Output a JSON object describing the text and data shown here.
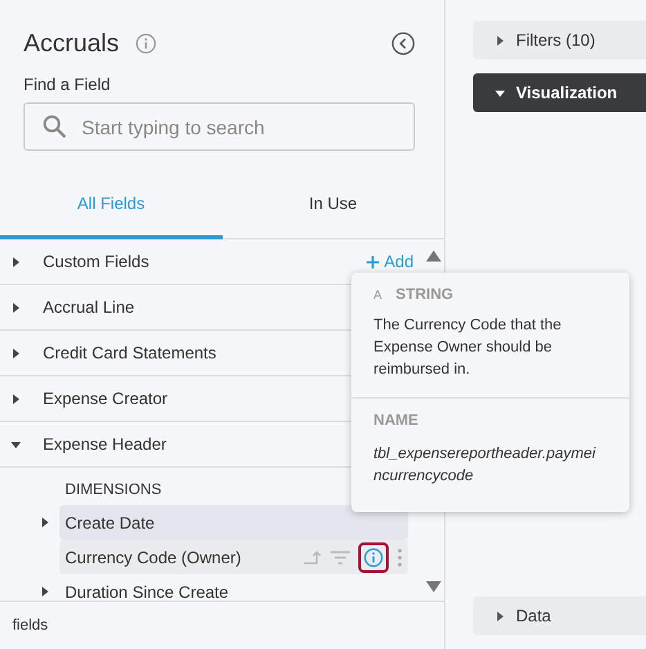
{
  "panel": {
    "title": "Accruals",
    "search_label": "Find a Field",
    "search_placeholder": "Start typing to search"
  },
  "tabs": [
    {
      "label": "All Fields",
      "selected": true
    },
    {
      "label": "In Use",
      "selected": false
    }
  ],
  "groups": [
    {
      "label": "Custom Fields",
      "expanded": false,
      "add_label": "Add"
    },
    {
      "label": "Accrual Line",
      "expanded": false
    },
    {
      "label": "Credit Card Statements",
      "expanded": false
    },
    {
      "label": "Expense Creator",
      "expanded": false
    },
    {
      "label": "Expense Header",
      "expanded": true,
      "section": "DIMENSIONS",
      "fields": [
        {
          "label": "Create Date",
          "expandable": true,
          "selected": true,
          "hovered": false
        },
        {
          "label": "Currency Code (Owner)",
          "expandable": false,
          "selected": false,
          "hovered": true
        },
        {
          "label": "Duration Since Create",
          "expandable": true,
          "selected": false,
          "hovered": false
        }
      ]
    }
  ],
  "footer": "fields",
  "tooltip": {
    "type_letter": "A",
    "type": "STRING",
    "description": "The Currency Code that the Expense Owner should be reimbursed in.",
    "name_label": "NAME",
    "name": "tbl_expensereportheader.paymei ncurrencycode"
  },
  "sections": [
    {
      "label": "Filters (10)",
      "expanded": false
    },
    {
      "label": "Visualization",
      "expanded": true
    },
    {
      "label": "Data",
      "expanded": false
    }
  ]
}
